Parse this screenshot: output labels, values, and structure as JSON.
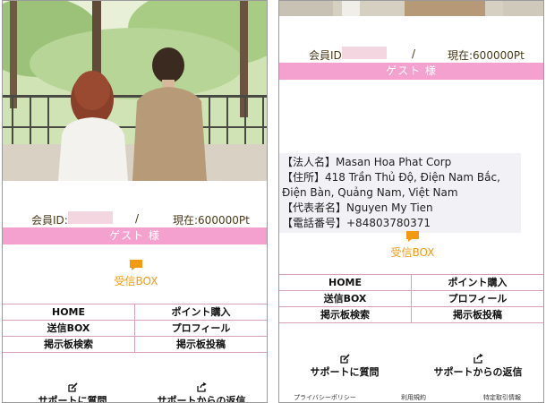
{
  "member": {
    "id_label": "会員ID:",
    "separator": "/",
    "points_label": "現在:600000Pt"
  },
  "guest_label": "ゲスト 様",
  "company": {
    "name": "【法人名】Masan Hoa Phat Corp",
    "address": "【住所】418 Trần Thủ Độ, Điện Nam Bắc, Điện Bàn, Quảng Nam, Việt Nam",
    "representative": "【代表者名】Nguyen My Tien",
    "phone": "【電話番号】+84803780371"
  },
  "inbox_label": "受信BOX",
  "nav": {
    "home": "HOME",
    "buy_points": "ポイント購入",
    "sent_box": "送信BOX",
    "profile": "プロフィール",
    "board_search": "掲示板検索",
    "board_post": "掲示板投稿"
  },
  "support": {
    "ask": "サポートに質問",
    "reply": "サポートからの返信"
  },
  "footer": {
    "privacy": "プライバシーポリシー",
    "terms": "利用規約",
    "commerce": "特定取引情報"
  },
  "colors": {
    "guest_bar": "#f5a1d0",
    "inbox_accent": "#f39a10",
    "nav_border": "#d8a0b8"
  }
}
